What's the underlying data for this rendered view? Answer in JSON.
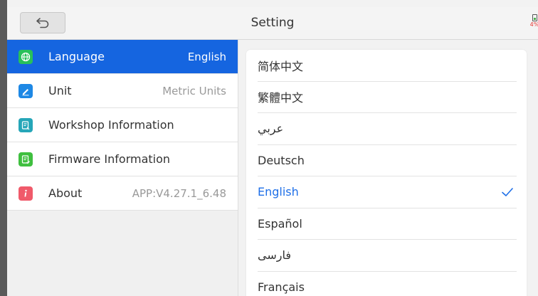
{
  "header": {
    "title": "Setting",
    "battery_pct": "4%"
  },
  "sidebar": {
    "items": [
      {
        "label": "Language",
        "value": "English",
        "active": true,
        "icon": "globe-icon",
        "color": "#28c05a"
      },
      {
        "label": "Unit",
        "value": "Metric Units",
        "active": false,
        "icon": "pencil-icon",
        "color": "#1e88e5"
      },
      {
        "label": "Workshop Information",
        "value": "",
        "active": false,
        "icon": "document-icon",
        "color": "#26a6b8"
      },
      {
        "label": "Firmware Information",
        "value": "",
        "active": false,
        "icon": "firmware-icon",
        "color": "#3fbf3f"
      },
      {
        "label": "About",
        "value": "APP:V4.27.1_6.48",
        "active": false,
        "icon": "info-icon",
        "color": "#f05a6a"
      }
    ]
  },
  "languages": [
    {
      "label": "简体中文",
      "selected": false
    },
    {
      "label": "繁體中文",
      "selected": false
    },
    {
      "label": "عربي",
      "selected": false
    },
    {
      "label": "Deutsch",
      "selected": false
    },
    {
      "label": "English",
      "selected": true
    },
    {
      "label": "Español",
      "selected": false
    },
    {
      "label": "فارسی",
      "selected": false
    },
    {
      "label": "Français",
      "selected": false
    }
  ],
  "colors": {
    "accent": "#1565e0",
    "selected_text": "#1e6fe8"
  }
}
